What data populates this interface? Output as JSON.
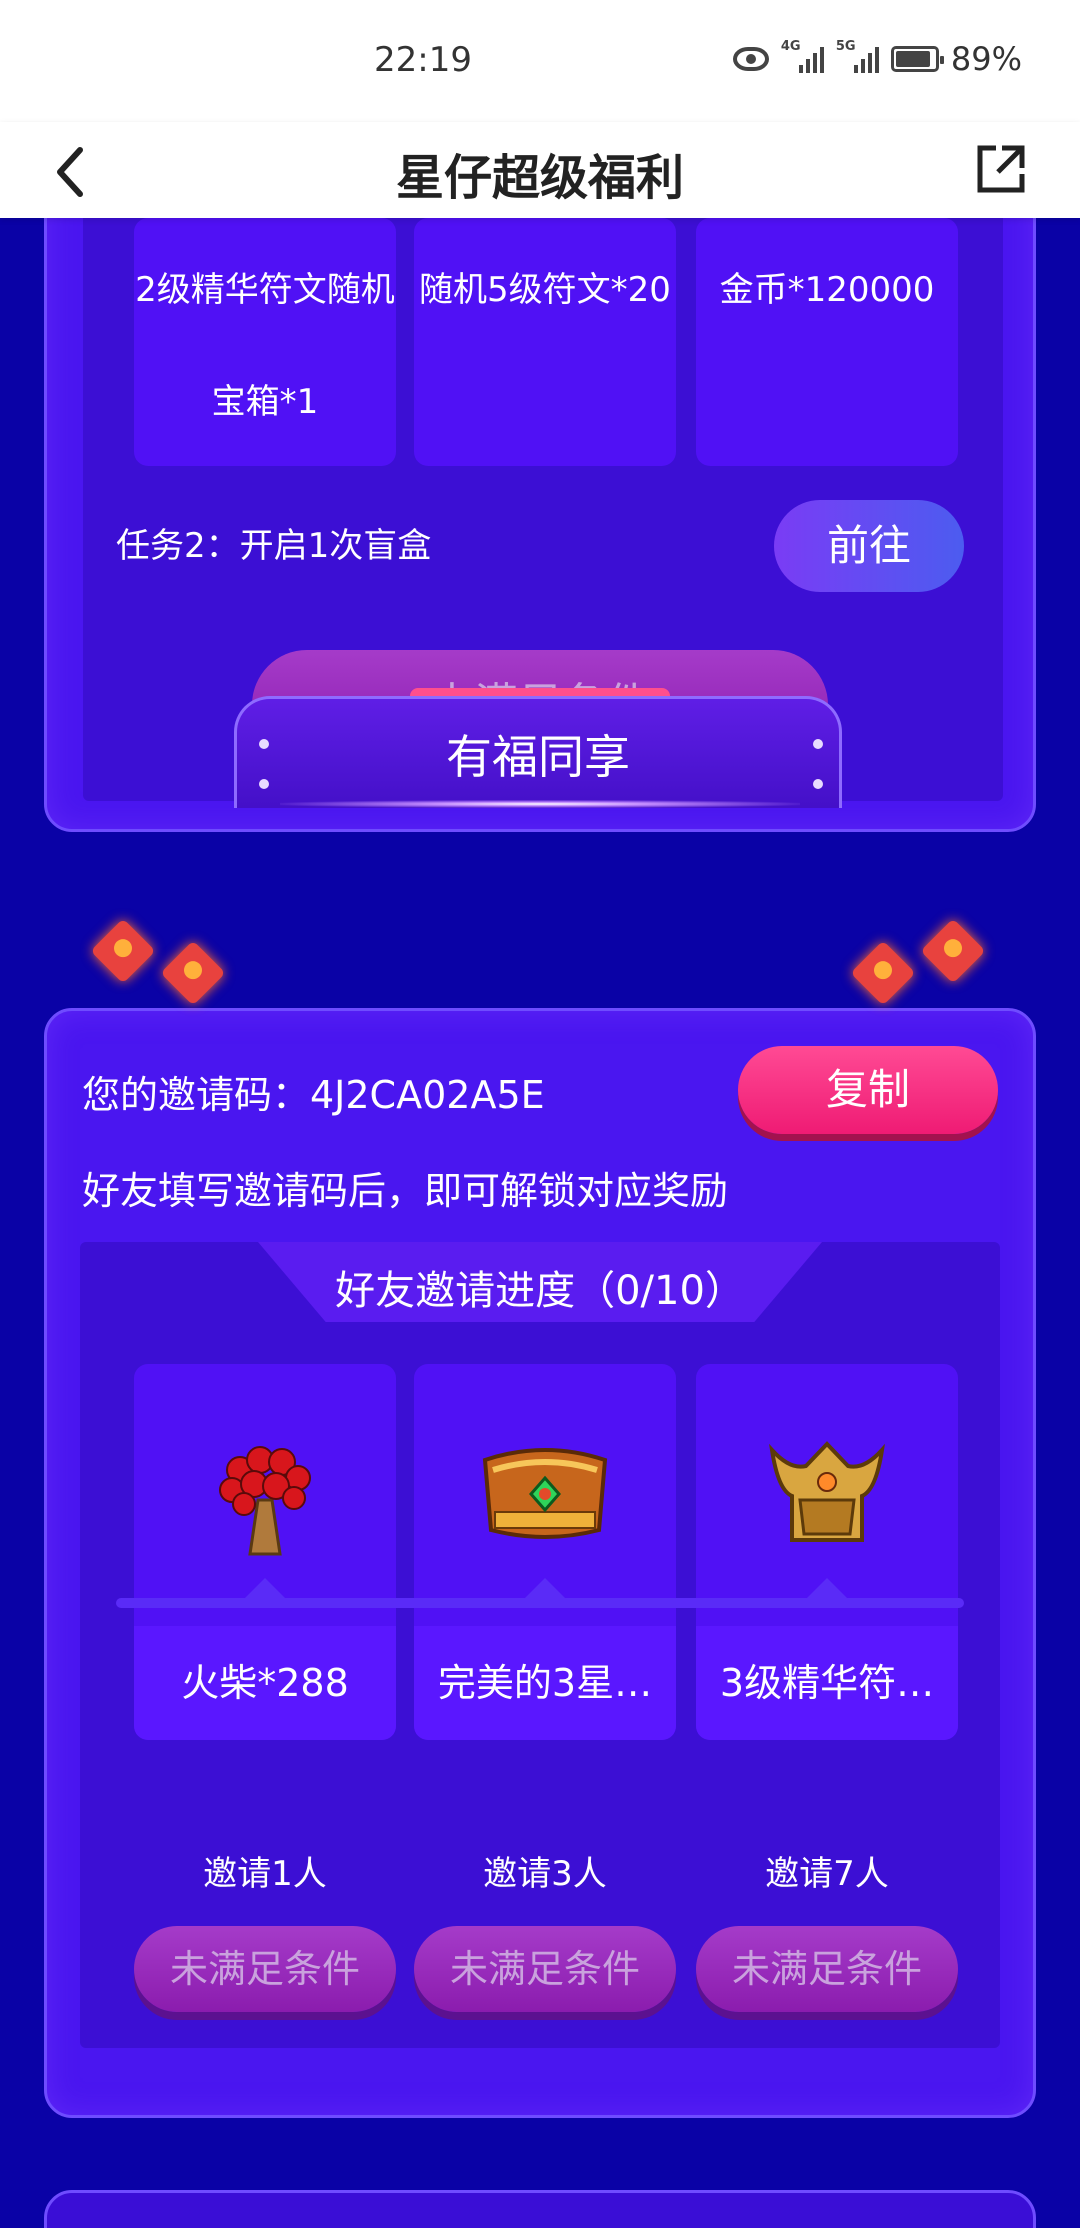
{
  "status_bar": {
    "time": "22:19",
    "battery": "89%",
    "battery_level": 0.89,
    "net1": "4G",
    "net2": "5G"
  },
  "nav": {
    "title": "星仔超级福利",
    "back_icon": "chevron-left-icon",
    "share_icon": "share-icon"
  },
  "task_panel": {
    "rewards": [
      {
        "line1": "2级精华符文随机",
        "line2": "宝箱*1"
      },
      {
        "line1": "随机5级符文*20",
        "line2": ""
      },
      {
        "line1": "金币*120000",
        "line2": ""
      }
    ],
    "task2_label": "任务2：开启1次盲盒",
    "go_button": "前往",
    "claim_button": "未满足条件"
  },
  "share_section": {
    "banner_title": "有福同享",
    "invite_label": "您的邀请码：4J2CA02A5E",
    "copy_button": "复制",
    "hint": "好友填写邀请码后，即可解锁对应奖励",
    "progress_title": "好友邀请进度（0/10）",
    "rewards": [
      {
        "name": "火柴*288",
        "icon": "match-bundle-icon",
        "milestone": "邀请1人",
        "button": "未满足条件"
      },
      {
        "name": "完美的3星…",
        "icon": "treasure-chest-icon",
        "milestone": "邀请3人",
        "button": "未满足条件"
      },
      {
        "name": "3级精华符…",
        "icon": "golden-helmet-icon",
        "milestone": "邀请7人",
        "button": "未满足条件"
      }
    ]
  }
}
